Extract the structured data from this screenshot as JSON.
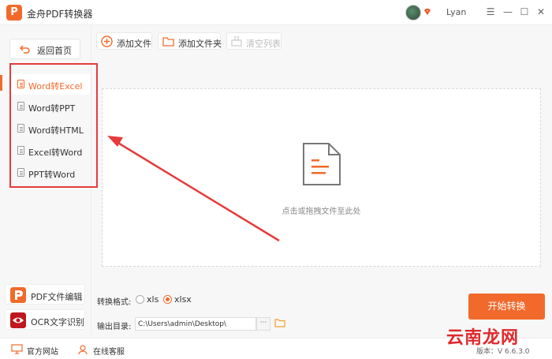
{
  "app": {
    "logo_text": "P",
    "title": "金舟PDF转换器",
    "username": "Lyan",
    "avatar_icon": "user-avatar",
    "vip_icon": "diamond-icon"
  },
  "window": {
    "minimize": "—",
    "restore": "☐",
    "maximize": "☐",
    "close": "✕"
  },
  "sidebar": {
    "back_label": "返回首页",
    "items": [
      {
        "label": "Word转Excel",
        "active": true
      },
      {
        "label": "Word转PPT",
        "active": false
      },
      {
        "label": "Word转HTML",
        "active": false
      },
      {
        "label": "Excel转Word",
        "active": false
      },
      {
        "label": "PPT转Word",
        "active": false
      }
    ],
    "tools": [
      {
        "label": "PDF文件编辑",
        "icon": "pdf-edit-icon",
        "color": "#f26a2b"
      },
      {
        "label": "OCR文字识别",
        "icon": "ocr-eye-icon",
        "color": "#c0161d"
      }
    ]
  },
  "toolbar": {
    "add_file": "添加文件",
    "add_folder": "添加文件夹",
    "clear_list": "清空列表"
  },
  "dropzone": {
    "hint": "点击或拖拽文件至此处"
  },
  "settings": {
    "format_label": "转换格式:",
    "options": [
      "xls",
      "xlsx"
    ],
    "selected": "xlsx",
    "output_label": "输出目录:",
    "output_path": "C:\\Users\\admin\\Desktop\\",
    "browse_label": "···"
  },
  "start_button": "开始转换",
  "footer": {
    "website": "官方网站",
    "support": "在线客服",
    "version": "版本：V 6.6.3.0"
  },
  "watermark": "云南龙网",
  "colors": {
    "accent": "#f26a2b",
    "highlight_box": "#e63b3b"
  }
}
